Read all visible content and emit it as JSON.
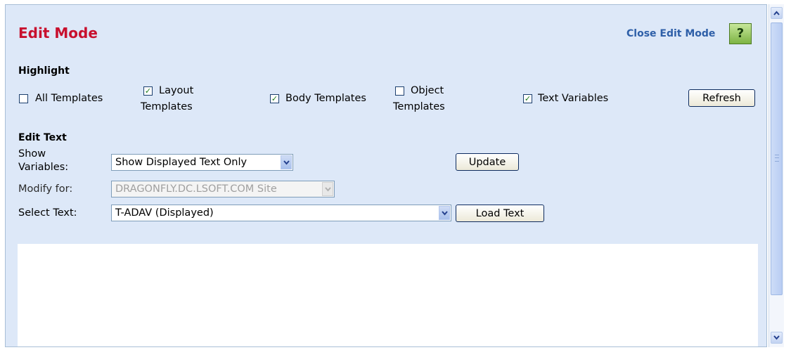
{
  "panel": {
    "title": "Edit Mode",
    "close_link": "Close Edit Mode",
    "help_label": "?"
  },
  "highlight": {
    "heading": "Highlight",
    "options": [
      {
        "label": "All Templates",
        "checked": false
      },
      {
        "label_line1": "Layout",
        "label_line2": "Templates",
        "checked": true
      },
      {
        "label": "Body Templates",
        "checked": true
      },
      {
        "label_line1": "Object",
        "label_line2": "Templates",
        "checked": false
      },
      {
        "label": "Text Variables",
        "checked": true
      }
    ],
    "refresh_label": "Refresh"
  },
  "edit_text": {
    "heading": "Edit Text",
    "show_variables": {
      "label_line1": "Show",
      "label_line2": "Variables:",
      "value": "Show Displayed Text Only"
    },
    "update_label": "Update",
    "modify_for": {
      "label": "Modify for:",
      "value": "DRAGONFLY.DC.LSOFT.COM Site"
    },
    "select_text": {
      "label": "Select Text:",
      "value": "T-ADAV (Displayed)"
    },
    "load_text_label": "Load Text"
  },
  "colors": {
    "title": "#c8102e",
    "link": "#2e5fa8",
    "panel_bg": "#dde8f8"
  }
}
